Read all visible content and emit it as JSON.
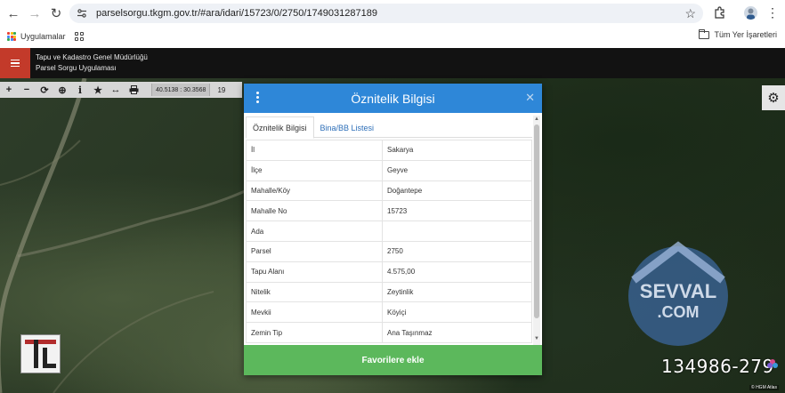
{
  "browser": {
    "url": "parselsorgu.tkgm.gov.tr/#ara/idari/15723/0/2750/1749031287189",
    "bookmarks": {
      "apps_label": "Uygulamalar",
      "all_bookmarks_label": "Tüm Yer İşaretleri"
    }
  },
  "app": {
    "title_line1": "Tapu ve Kadastro Genel Müdürlüğü",
    "title_line2": "Parsel Sorgu Uygulaması",
    "accent_color": "#c33a2a"
  },
  "map_toolbar": {
    "coordinates": "40.5138 : 30.3568",
    "zoom_level": "19",
    "tools": [
      "plus-icon",
      "minus-icon",
      "refresh-icon",
      "locate-icon",
      "info-icon",
      "star-icon",
      "measure-icon",
      "print-icon"
    ]
  },
  "dialog": {
    "title": "Öznitelik Bilgisi",
    "header_color": "#2e87d8",
    "tabs": [
      {
        "label": "Öznitelik Bilgisi",
        "active": true
      },
      {
        "label": "Bina/BB Listesi",
        "active": false
      }
    ],
    "rows": [
      {
        "key": "İl",
        "value": "Sakarya"
      },
      {
        "key": "İlçe",
        "value": "Geyve"
      },
      {
        "key": "Mahalle/Köy",
        "value": "Doğantepe"
      },
      {
        "key": "Mahalle No",
        "value": "15723"
      },
      {
        "key": "Ada",
        "value": ""
      },
      {
        "key": "Parsel",
        "value": "2750"
      },
      {
        "key": "Tapu Alanı",
        "value": "4.575,00"
      },
      {
        "key": "Nitelik",
        "value": "Zeytinlik"
      },
      {
        "key": "Mevkii",
        "value": "Köyiçi"
      },
      {
        "key": "Zemin Tip",
        "value": "Ana Taşınmaz"
      }
    ],
    "favorite_button": "Favorilere ekle",
    "favorite_color": "#5cb85c"
  },
  "overlay": {
    "listing_number": "134986-279",
    "attribution": "© HGM Atlas",
    "watermark_text": "SEVVAL.COM"
  }
}
